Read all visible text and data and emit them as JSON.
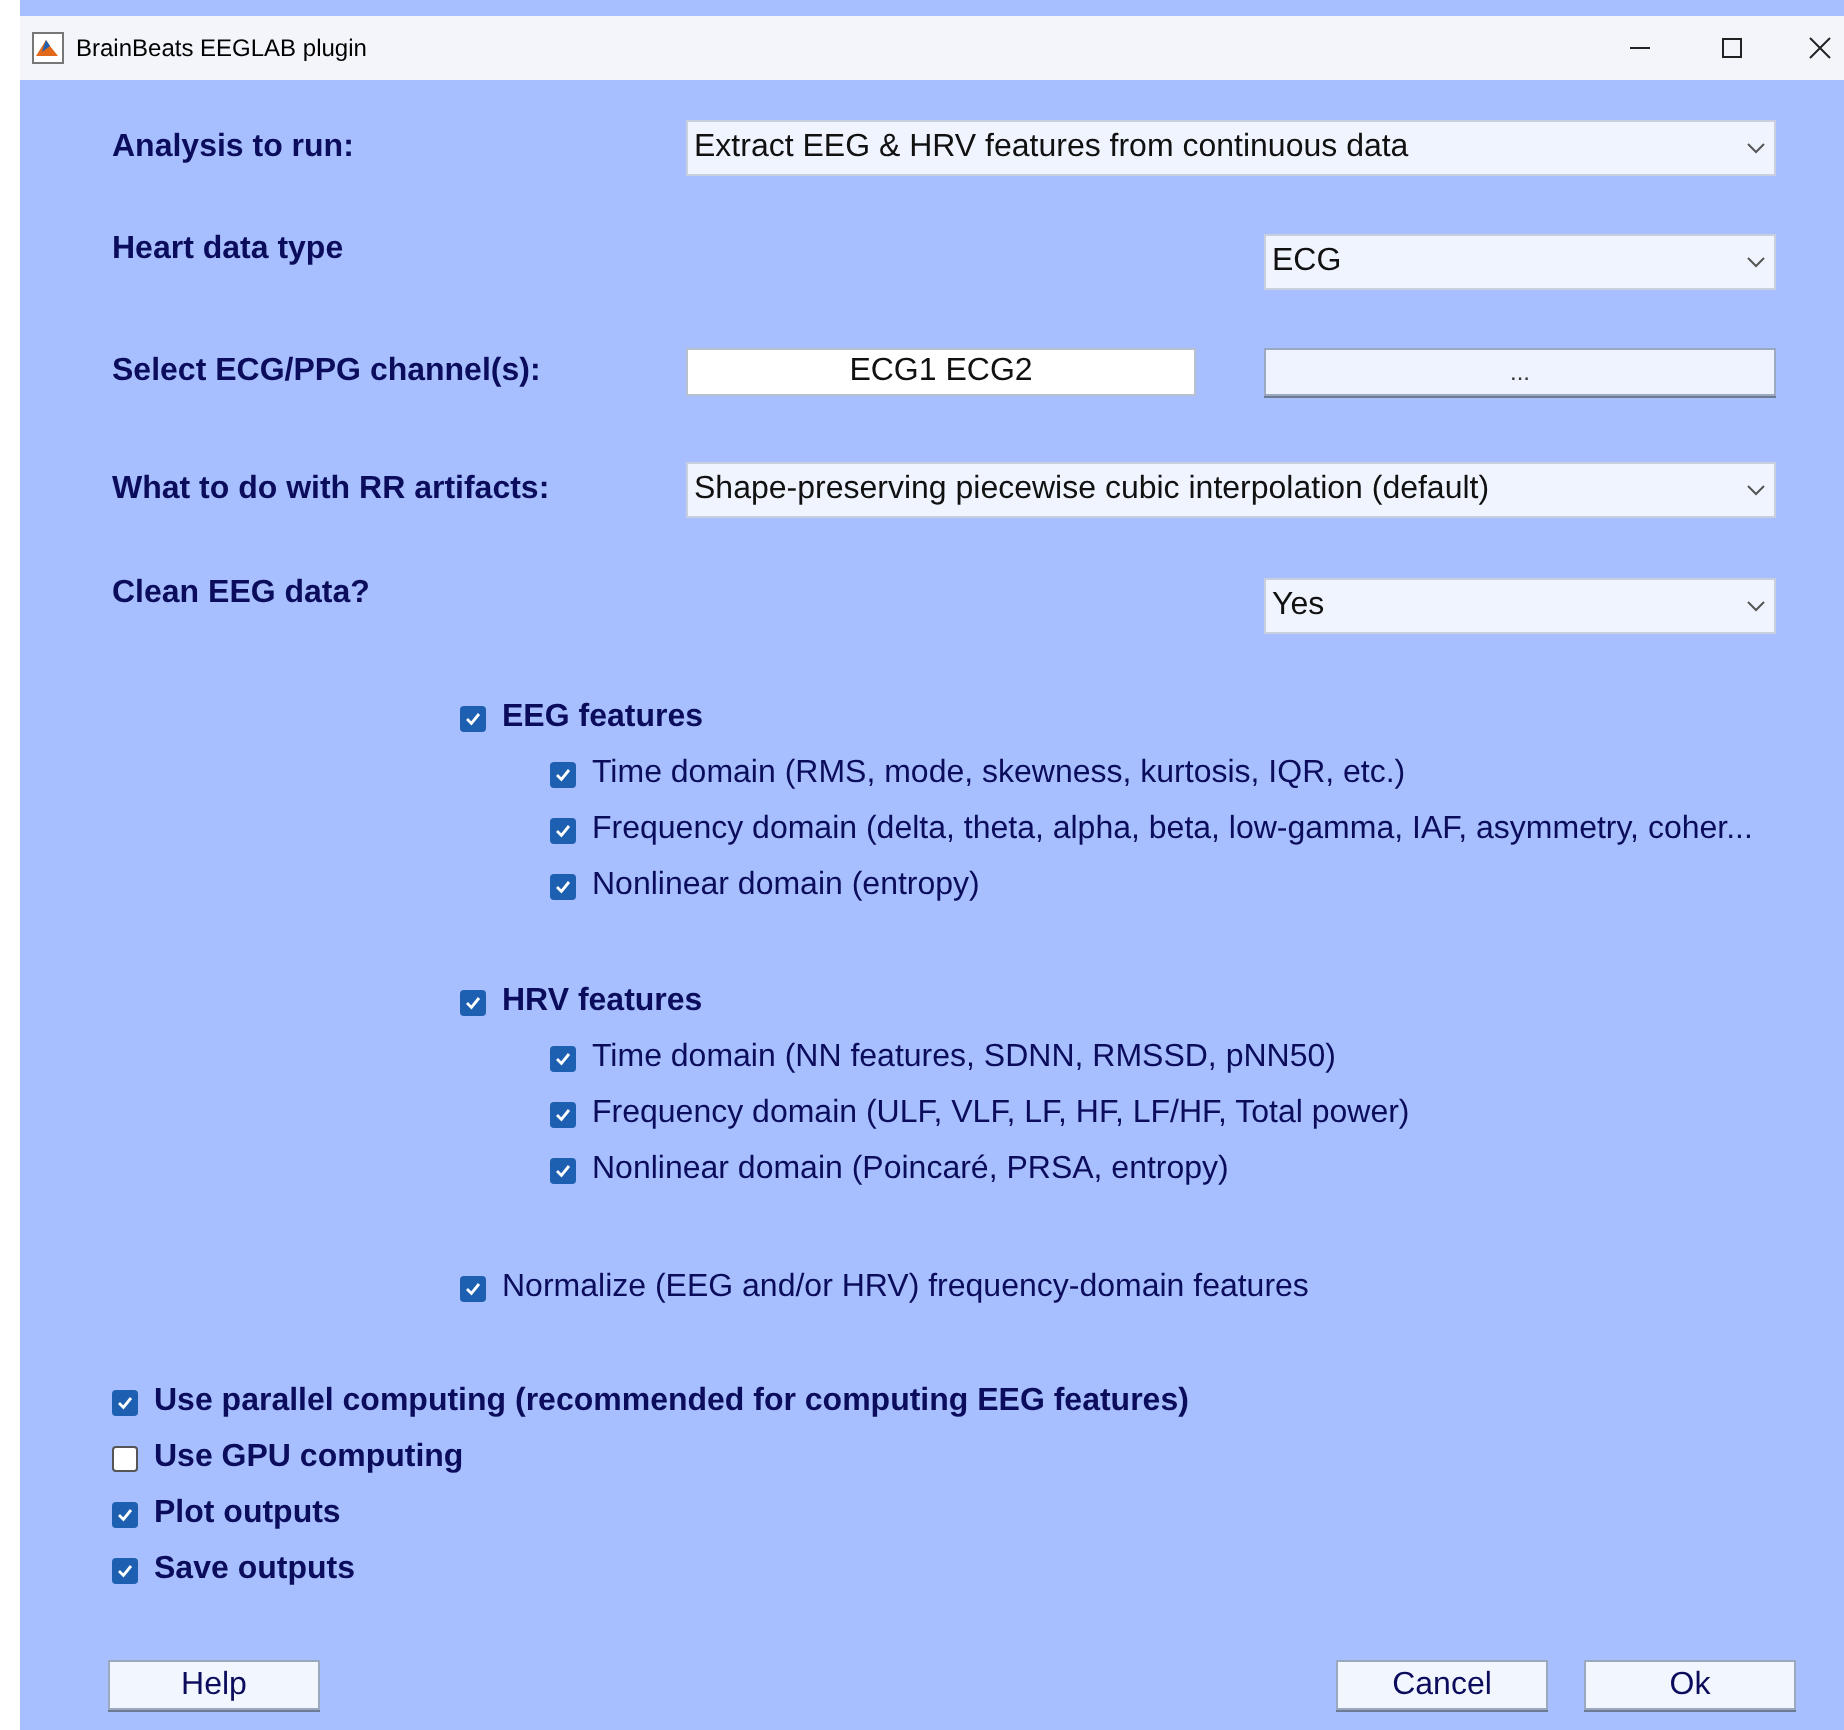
{
  "window": {
    "title": "BrainBeats EEGLAB plugin"
  },
  "fields": [
    {
      "kind": "wide_dropdown",
      "label": "Analysis to run:",
      "value": "Extract EEG & HRV features from continuous data"
    },
    {
      "kind": "narrow_dropdown",
      "label": "Heart data type",
      "value": "ECG"
    },
    {
      "kind": "text_with_button",
      "label": "Select ECG/PPG channel(s):",
      "value": "ECG1 ECG2",
      "button_label": "..."
    },
    {
      "kind": "wide_dropdown",
      "label": "What to do with RR artifacts:",
      "value": "Shape-preserving piecewise cubic interpolation (default)"
    },
    {
      "kind": "narrow_dropdown",
      "label": "Clean EEG data?",
      "value": "Yes"
    }
  ],
  "feature_groups": [
    {
      "label": "EEG features",
      "checked": true,
      "children": [
        {
          "label": "Time domain (RMS, mode, skewness, kurtosis, IQR, etc.)",
          "checked": true
        },
        {
          "label": "Frequency domain (delta, theta, alpha, beta, low-gamma, IAF, asymmetry, coher...",
          "checked": true
        },
        {
          "label": "Nonlinear domain (entropy)",
          "checked": true
        }
      ]
    },
    {
      "label": "HRV features",
      "checked": true,
      "children": [
        {
          "label": "Time domain (NN features, SDNN, RMSSD, pNN50)",
          "checked": true
        },
        {
          "label": "Frequency domain (ULF, VLF, LF, HF, LF/HF, Total power)",
          "checked": true
        },
        {
          "label": "Nonlinear domain (Poincaré, PRSA, entropy)",
          "checked": true
        }
      ]
    }
  ],
  "normalize": {
    "label": "Normalize (EEG and/or HRV) frequency-domain features",
    "checked": true
  },
  "options": [
    {
      "label": "Use parallel computing (recommended for computing EEG features)",
      "checked": true
    },
    {
      "label": "Use GPU computing",
      "checked": false
    },
    {
      "label": "Plot outputs",
      "checked": true
    },
    {
      "label": "Save outputs",
      "checked": true
    }
  ],
  "buttons_left": [
    "Help"
  ],
  "buttons_right": [
    "Cancel",
    "Ok"
  ]
}
